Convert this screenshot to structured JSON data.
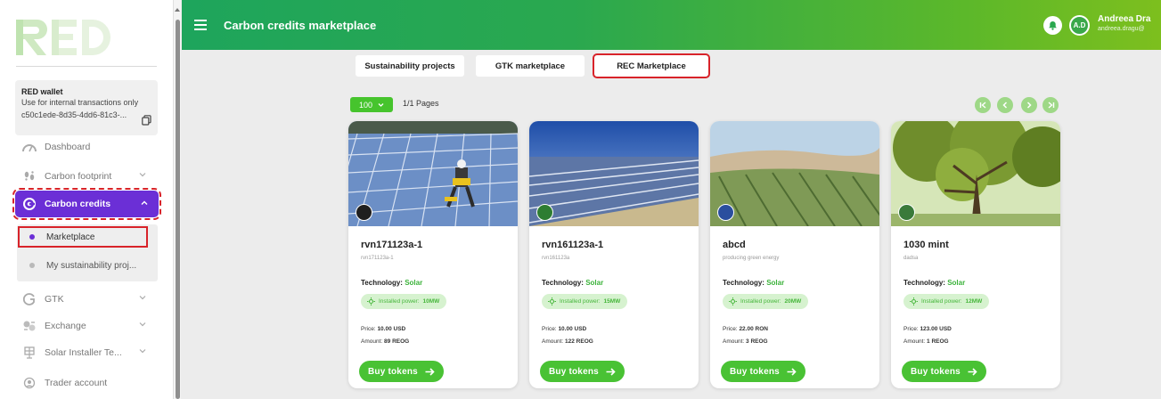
{
  "header": {
    "title": "Carbon credits marketplace",
    "user_initials": "A.D",
    "user_name": "Andreea Dra",
    "user_email": "andreea.dragu@"
  },
  "brand": {
    "logo_text": "RED",
    "accent": "#6b2fd6",
    "green": "#46c42d",
    "highlight": "#d8232a"
  },
  "wallet": {
    "title": "RED wallet",
    "subtitle": "Use for internal transactions only",
    "id": "c50c1ede-8d35-4dd6-81c3-..."
  },
  "sidebar": {
    "items": [
      {
        "label": "Dashboard",
        "icon": "dashboard-icon"
      },
      {
        "label": "Carbon footprint",
        "icon": "footprint-icon"
      },
      {
        "label": "Carbon credits",
        "icon": "carbon-credits-icon"
      },
      {
        "label": "Marketplace"
      },
      {
        "label": "My sustainability proj..."
      },
      {
        "label": "GTK",
        "icon": "gtk-icon"
      },
      {
        "label": "Exchange",
        "icon": "exchange-icon"
      },
      {
        "label": "Solar Installer Te...",
        "icon": "solar-icon"
      },
      {
        "label": "Trader account",
        "icon": "trader-icon"
      }
    ]
  },
  "tabs": [
    {
      "label": "Sustainability projects"
    },
    {
      "label": "GTK marketplace"
    },
    {
      "label": "REC Marketplace"
    }
  ],
  "pagination": {
    "per_page": "100",
    "pages": "1/1 Pages"
  },
  "cards": [
    {
      "name": "rvn171123a-1",
      "desc": "rvn171123a-1",
      "tech_label": "Technology:",
      "tech": "Solar",
      "power_label": "Installed power:",
      "power": "10MW",
      "price_label": "Price:",
      "price": "10.00 USD",
      "amount_label": "Amount:",
      "amount": "89 REOG",
      "buy": "Buy tokens"
    },
    {
      "name": "rvn161123a-1",
      "desc": "rvn161123a",
      "tech_label": "Technology:",
      "tech": "Solar",
      "power_label": "Installed power:",
      "power": "15MW",
      "price_label": "Price:",
      "price": "10.00 USD",
      "amount_label": "Amount:",
      "amount": "122 REOG",
      "buy": "Buy tokens"
    },
    {
      "name": "abcd",
      "desc": "producing green energy",
      "tech_label": "Technology:",
      "tech": "Solar",
      "power_label": "Installed power:",
      "power": "20MW",
      "price_label": "Price:",
      "price": "22.00 RON",
      "amount_label": "Amount:",
      "amount": "3 REOG",
      "buy": "Buy tokens"
    },
    {
      "name": "1030 mint",
      "desc": "dadsa",
      "tech_label": "Technology:",
      "tech": "Solar",
      "power_label": "Installed power:",
      "power": "12MW",
      "price_label": "Price:",
      "price": "123.00 USD",
      "amount_label": "Amount:",
      "amount": "1 REOG",
      "buy": "Buy tokens"
    }
  ]
}
